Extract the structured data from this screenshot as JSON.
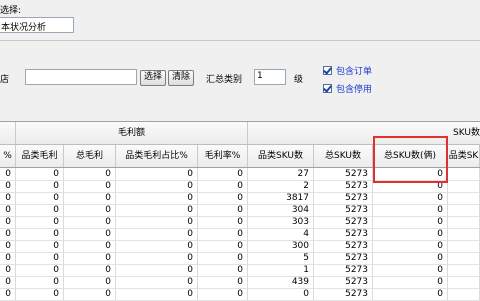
{
  "form": {
    "select_label": "选择:",
    "report_name": "本状况分析",
    "store_label": "店",
    "store_value": "",
    "select_btn": "选择",
    "clear_btn": "清除",
    "summary_type_label": "汇总类别",
    "summary_type_value": "1",
    "level_label": "级",
    "include_order_label": "包含订单",
    "include_disabled_label": "包含停用"
  },
  "table": {
    "group_headers": {
      "gross_profit": "毛利额",
      "sku": "SKU数"
    },
    "columns": [
      "%",
      "品类毛利",
      "总毛利",
      "品类毛利占比%",
      "毛利率%",
      "品类SKU数",
      "总SKU数",
      "总SKU数(俩)",
      "品类SK"
    ],
    "rows": [
      [
        "0",
        "0",
        "0",
        "0",
        "0",
        "27",
        "5273",
        "0",
        ""
      ],
      [
        "0",
        "0",
        "0",
        "0",
        "0",
        "2",
        "5273",
        "0",
        ""
      ],
      [
        "0",
        "0",
        "0",
        "0",
        "0",
        "3817",
        "5273",
        "0",
        ""
      ],
      [
        "0",
        "0",
        "0",
        "0",
        "0",
        "304",
        "5273",
        "0",
        ""
      ],
      [
        "0",
        "0",
        "0",
        "0",
        "0",
        "303",
        "5273",
        "0",
        ""
      ],
      [
        "0",
        "0",
        "0",
        "0",
        "0",
        "4",
        "5273",
        "0",
        ""
      ],
      [
        "0",
        "0",
        "0",
        "0",
        "0",
        "300",
        "5273",
        "0",
        ""
      ],
      [
        "0",
        "0",
        "0",
        "0",
        "0",
        "5",
        "5273",
        "0",
        ""
      ],
      [
        "0",
        "0",
        "0",
        "0",
        "0",
        "1",
        "5273",
        "0",
        ""
      ],
      [
        "0",
        "0",
        "0",
        "0",
        "0",
        "439",
        "5273",
        "0",
        ""
      ],
      [
        "0",
        "0",
        "0",
        "0",
        "0",
        "0",
        "5273",
        "0",
        ""
      ]
    ]
  }
}
